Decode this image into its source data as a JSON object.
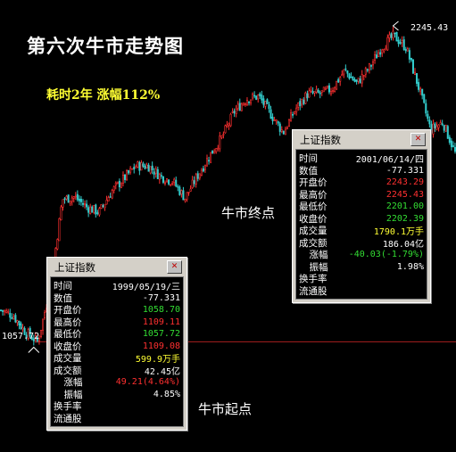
{
  "chart_data": {
    "type": "candlestick",
    "title": "第六次牛市走势图",
    "subtitle": "耗时2年 涨幅112%",
    "ylim": [
      1000,
      2280
    ],
    "low_point": 1057.72,
    "high_point": 2245.43,
    "trend": [
      1180,
      1160,
      1095,
      1057.72,
      1260,
      1610,
      1620,
      1580,
      1560,
      1640,
      1690,
      1740,
      1740,
      1700,
      1680,
      1615,
      1700,
      1780,
      1850,
      1950,
      2000,
      2010,
      1940,
      1870,
      1960,
      2020,
      2020,
      2040,
      2110,
      2060,
      2120,
      2200,
      2245.43,
      2200,
      2050,
      1880,
      1910,
      1790
    ],
    "annotations": {
      "end": "牛市终点",
      "start": "牛市起点"
    }
  },
  "colors": {
    "up": "#ff3030",
    "down": "#33cccc",
    "green": "#33dd33",
    "yellow": "#ffff33",
    "baseline": "#aa2020"
  },
  "panels": [
    {
      "title": "上证指数",
      "rows": [
        {
          "label": "时间",
          "value": "1999/05/19/三",
          "color": "#ffffff"
        },
        {
          "label": "数值",
          "value": "-77.331",
          "color": "#ffffff"
        },
        {
          "label": "开盘价",
          "value": "1058.70",
          "color": "#33dd33"
        },
        {
          "label": "最高价",
          "value": "1109.11",
          "color": "#ff3030"
        },
        {
          "label": "最低价",
          "value": "1057.72",
          "color": "#33dd33"
        },
        {
          "label": "收盘价",
          "value": "1109.08",
          "color": "#ff3030"
        },
        {
          "label": "成交量",
          "value": "599.9万手",
          "color": "#ffff33"
        },
        {
          "label": "成交额",
          "value": "42.45亿",
          "color": "#ffffff"
        },
        {
          "label": "涨幅",
          "value": "49.21(4.64%)",
          "color": "#ff3030"
        },
        {
          "label": "振幅",
          "value": "4.85%",
          "color": "#ffffff"
        },
        {
          "label": "换手率",
          "value": "",
          "color": "#ffffff"
        },
        {
          "label": "流通股",
          "value": "",
          "color": "#ffffff"
        }
      ]
    },
    {
      "title": "上证指数",
      "rows": [
        {
          "label": "时间",
          "value": "2001/06/14/四",
          "color": "#ffffff"
        },
        {
          "label": "数值",
          "value": "-77.331",
          "color": "#ffffff"
        },
        {
          "label": "开盘价",
          "value": "2243.29",
          "color": "#ff3030"
        },
        {
          "label": "最高价",
          "value": "2245.43",
          "color": "#ff3030"
        },
        {
          "label": "最低价",
          "value": "2201.00",
          "color": "#33dd33"
        },
        {
          "label": "收盘价",
          "value": "2202.39",
          "color": "#33dd33"
        },
        {
          "label": "成交量",
          "value": "1790.1万手",
          "color": "#ffff33"
        },
        {
          "label": "成交额",
          "value": "186.04亿",
          "color": "#ffffff"
        },
        {
          "label": "涨幅",
          "value": "-40.03(-1.79%)",
          "color": "#33dd33"
        },
        {
          "label": "振幅",
          "value": "1.98%",
          "color": "#ffffff"
        },
        {
          "label": "换手率",
          "value": "",
          "color": "#ffffff"
        },
        {
          "label": "流通股",
          "value": "",
          "color": "#ffffff"
        }
      ]
    }
  ]
}
